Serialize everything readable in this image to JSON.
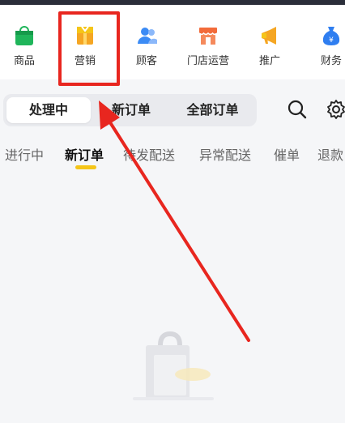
{
  "nav": {
    "items": [
      {
        "label": "商品"
      },
      {
        "label": "营销"
      },
      {
        "label": "顾客"
      },
      {
        "label": "门店运营"
      },
      {
        "label": "推广"
      },
      {
        "label": "财务"
      }
    ]
  },
  "segment_tabs": [
    {
      "label": "处理中",
      "active": true
    },
    {
      "label": "新订单",
      "active": false
    },
    {
      "label": "全部订单",
      "active": false
    }
  ],
  "status_tabs": [
    {
      "label": "进行中"
    },
    {
      "label": "新订单",
      "active": true
    },
    {
      "label": "待发配送"
    },
    {
      "label": "异常配送"
    },
    {
      "label": "催单"
    },
    {
      "label": "退款"
    }
  ],
  "finance_icon_glyph": "¥",
  "colors": {
    "accent_yellow": "#f5c518",
    "annotation_red": "#e8261f",
    "goods_green": "#1fb55a",
    "marketing_orange": "#f5a623",
    "customer_blue": "#3b8bf5",
    "store_orange": "#f26b3a",
    "promo_orange": "#f5a623",
    "finance_blue": "#2f7ef0"
  }
}
